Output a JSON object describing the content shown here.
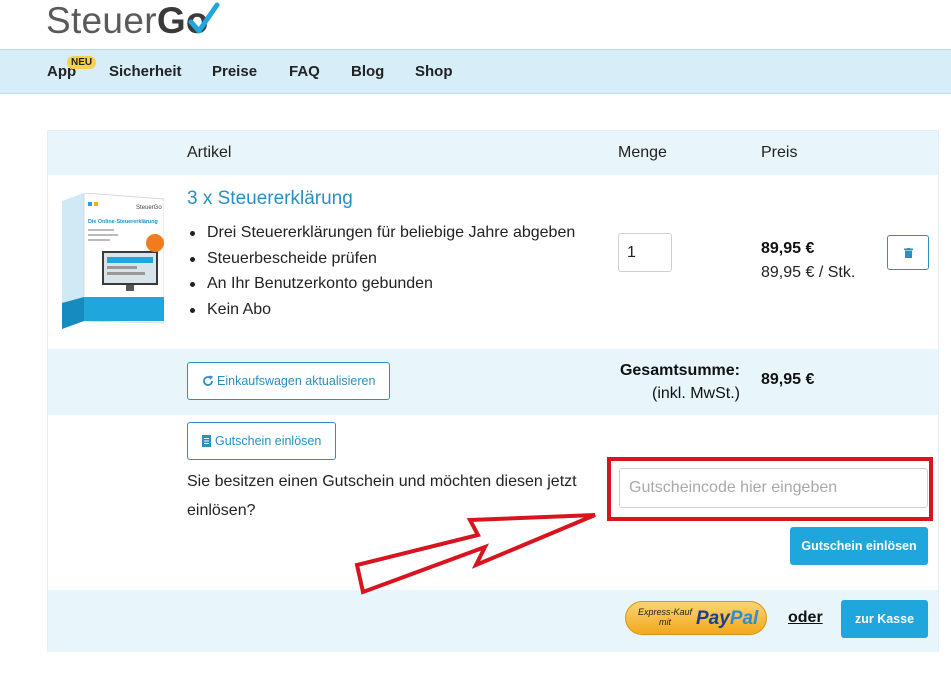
{
  "logo": {
    "text_light": "Steuer",
    "text_bold": "Go"
  },
  "nav": {
    "items": [
      "App",
      "Sicherheit",
      "Preise",
      "FAQ",
      "Blog",
      "Shop"
    ],
    "badge": "NEU"
  },
  "cart": {
    "headers": {
      "article": "Artikel",
      "quantity": "Menge",
      "price": "Preis"
    },
    "item": {
      "title": "3 x Steuererklärung",
      "features": [
        "Drei Steuererklärungen für beliebige Jahre abgeben",
        "Steuerbescheide prüfen",
        "An Ihr Benutzerkonto gebunden",
        "Kein Abo"
      ],
      "quantity": "1",
      "price": "89,95 €",
      "unit_price": "89,95 € / Stk.",
      "box_label": "Die Online-Steuererklärung",
      "box_brand": "SteuerGo"
    },
    "update_button": "Einkaufswagen aktualisieren",
    "total_label": "Gesamtsumme:",
    "total_note": "(inkl. MwSt.)",
    "total_value": "89,95 €"
  },
  "coupon": {
    "toggle_button": "Gutschein einlösen",
    "question": "Sie besitzen einen Gutschein und möchten diesen jetzt einlösen?",
    "input_placeholder": "Gutscheincode hier eingeben",
    "input_value": "",
    "submit_button": "Gutschein einlösen"
  },
  "checkout": {
    "paypal_small": "Express-Kauf mit",
    "paypal_pay": "Pay",
    "paypal_pal": "Pal",
    "or_text": "oder",
    "checkout_button": "zur Kasse"
  },
  "colors": {
    "accent": "#1ea6dd",
    "link": "#2a8fc1",
    "nav_bg": "#d7eef8",
    "row_bg": "#e8f6fb",
    "annotation": "#d8151f"
  }
}
